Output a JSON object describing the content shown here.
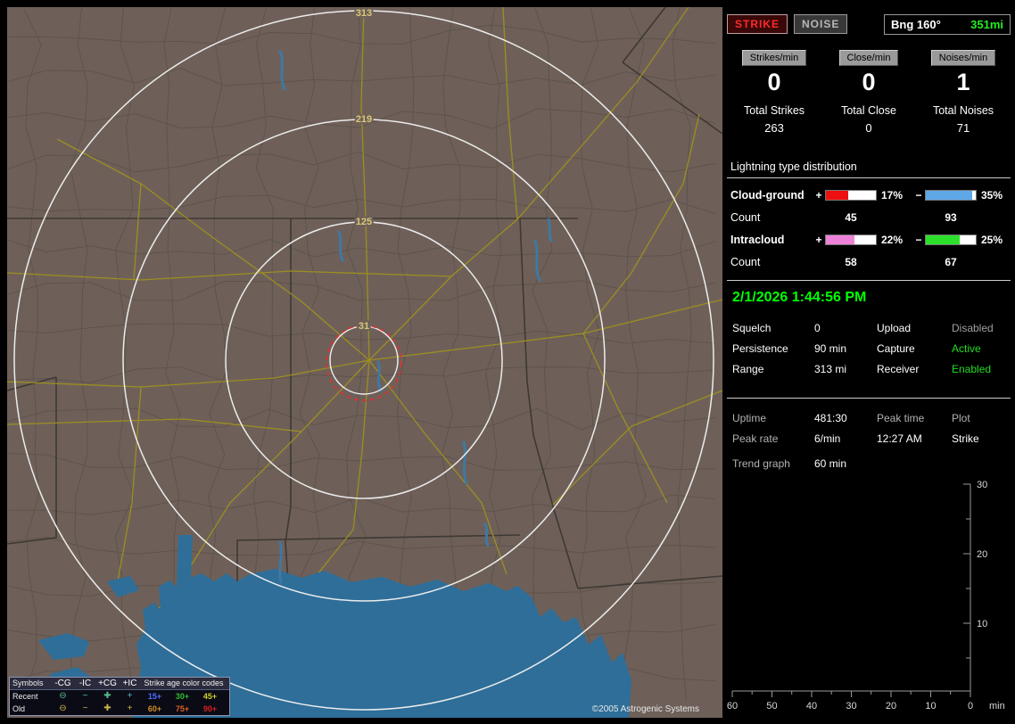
{
  "map": {
    "ring_labels": [
      "313",
      "219",
      "125",
      "31"
    ],
    "copyright": "©2005 Astrogenic Systems",
    "legend": {
      "symbols_header": "Symbols",
      "columns": [
        "-CG",
        "-IC",
        "+CG",
        "+IC"
      ],
      "age_header": "Strike age color codes",
      "recent_label": "Recent",
      "old_label": "Old",
      "recent_symbols": [
        {
          "glyph": "⊖",
          "color": "#55c08a"
        },
        {
          "glyph": "−",
          "color": "#49c0c0"
        },
        {
          "glyph": "✚",
          "color": "#55c08a"
        },
        {
          "glyph": "+",
          "color": "#49c0c0"
        }
      ],
      "old_symbols": [
        {
          "glyph": "⊖",
          "color": "#c8b44c"
        },
        {
          "glyph": "−",
          "color": "#c8b44c"
        },
        {
          "glyph": "✚",
          "color": "#c8b44c"
        },
        {
          "glyph": "+",
          "color": "#c8b44c"
        }
      ],
      "recent_ages": [
        {
          "text": "15+",
          "color": "#4f6dff"
        },
        {
          "text": "30+",
          "color": "#2fbf2f"
        },
        {
          "text": "45+",
          "color": "#cfcf2a"
        }
      ],
      "old_ages": [
        {
          "text": "60+",
          "color": "#cf8f1f"
        },
        {
          "text": "75+",
          "color": "#df5f1f"
        },
        {
          "text": "90+",
          "color": "#df1f1f"
        }
      ]
    }
  },
  "sidebar": {
    "controls": {
      "strike_label": "STRIKE",
      "noise_label": "NOISE",
      "bearing_label": "Bng 160°",
      "distance_label": "351mi",
      "strike_color": "#ff2a2a",
      "distance_color": "#22ee22"
    },
    "rates": [
      {
        "label": "Strikes/min",
        "value": "0"
      },
      {
        "label": "Close/min",
        "value": "0"
      },
      {
        "label": "Noises/min",
        "value": "1"
      }
    ],
    "totals": [
      {
        "label": "Total Strikes",
        "value": "263"
      },
      {
        "label": "Total Close",
        "value": "0"
      },
      {
        "label": "Total Noises",
        "value": "71"
      }
    ],
    "distribution": {
      "title": "Lightning type distribution",
      "count_label": "Count",
      "rows": [
        {
          "name": "Cloud-ground",
          "plus": "+",
          "minus": "−",
          "pos_pct": "17%",
          "neg_pct": "35%",
          "pos_count": "45",
          "neg_count": "93",
          "pos_fill": 45,
          "neg_fill": 93,
          "pos_color": "#ee1010",
          "neg_color": "#5fa8e8"
        },
        {
          "name": "Intracloud",
          "plus": "+",
          "minus": "−",
          "pos_pct": "22%",
          "neg_pct": "25%",
          "pos_count": "58",
          "neg_count": "67",
          "pos_fill": 58,
          "neg_fill": 67,
          "pos_color": "#ee82d8",
          "neg_color": "#2ce02c"
        }
      ]
    },
    "datetime": "2/1/2026 1:44:56 PM",
    "settings": [
      {
        "label": "Squelch",
        "value": "0",
        "label2": "Upload",
        "value2": "Disabled",
        "value2_color": "#a0a0a0"
      },
      {
        "label": "Persistence",
        "value": "90 min",
        "label2": "Capture",
        "value2": "Active",
        "value2_color": "#22dd22"
      },
      {
        "label": "Range",
        "value": "313 mi",
        "label2": "Receiver",
        "value2": "Enabled",
        "value2_color": "#22dd22"
      }
    ],
    "status": {
      "r1c1": "Uptime",
      "r1c2": "481:30",
      "r1c3": "Peak time",
      "r1c4": "Plot",
      "r2c1": "Peak rate",
      "r2c2": "6/min",
      "r2c3": "12:27 AM",
      "r2c4": "Strike"
    },
    "trend": {
      "label": "Trend graph",
      "value": "60 min"
    },
    "graph": {
      "y_ticks": [
        "30",
        "20",
        "10"
      ],
      "x_ticks": [
        "60",
        "50",
        "40",
        "30",
        "20",
        "10",
        "0"
      ],
      "x_unit": "min"
    }
  }
}
